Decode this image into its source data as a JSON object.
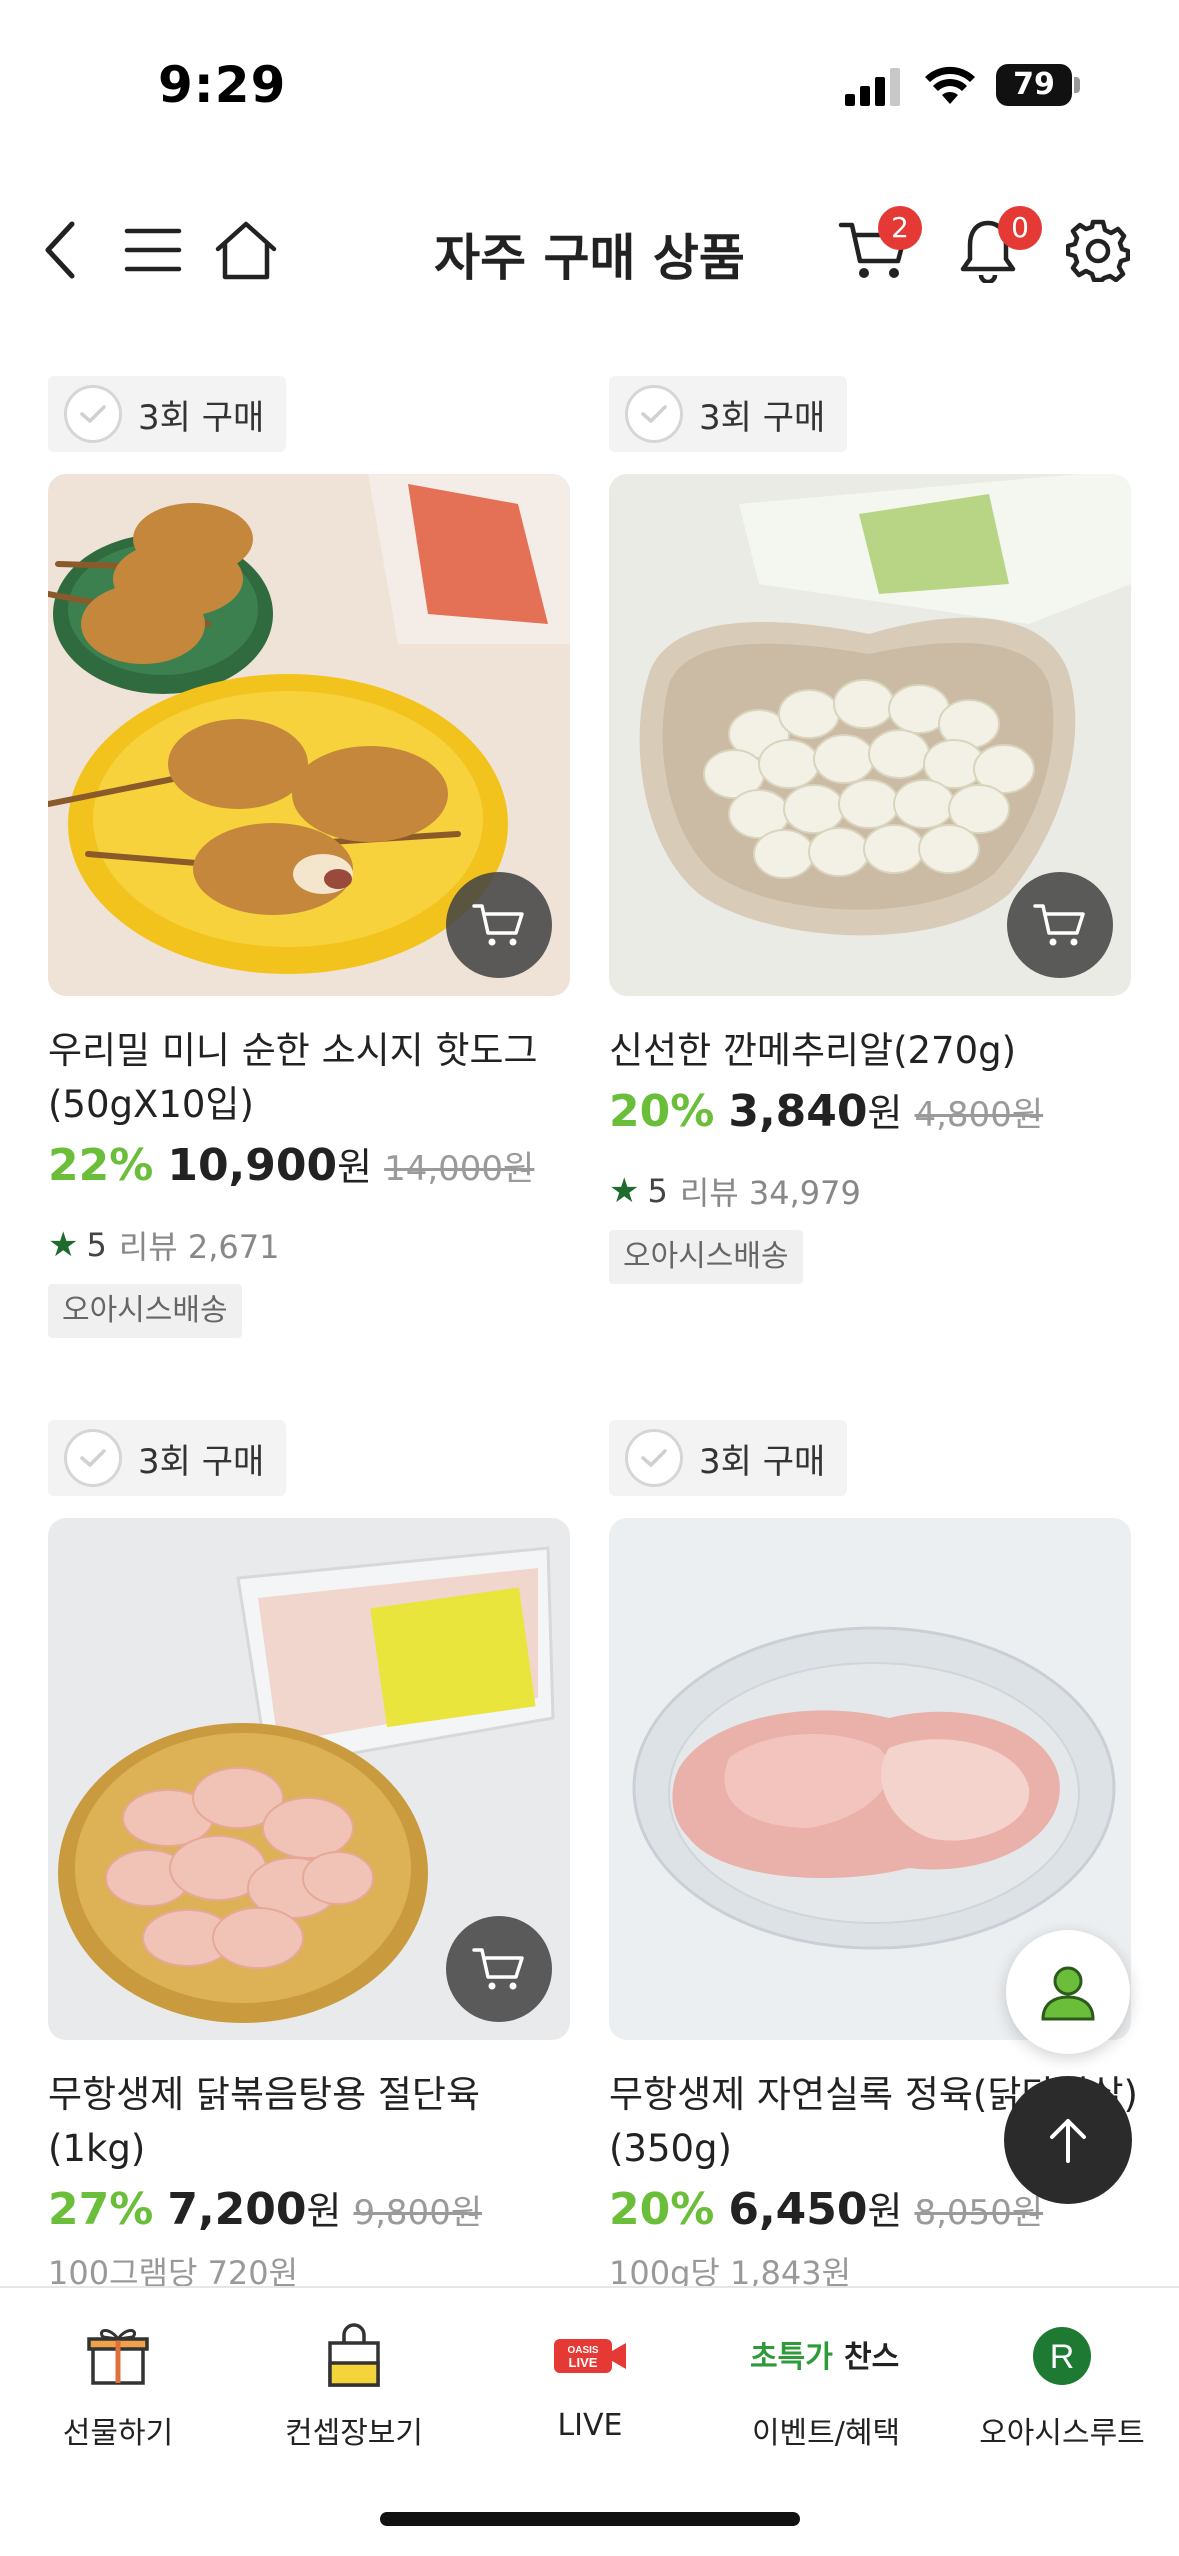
{
  "status_bar": {
    "time": "9:29",
    "battery": "79"
  },
  "header": {
    "title": "자주 구매 상품",
    "cart_count": "2",
    "notification_count": "0"
  },
  "products": [
    {
      "buy_count": "3회 구매",
      "name": "우리밀 미니 순한 소시지 핫도그 (50gX10입)",
      "discount": "22%",
      "price": "10,900",
      "won": "원",
      "original_price": "14,000원",
      "rating": "5",
      "reviews": "리뷰 2,671",
      "tag": "오아시스배송"
    },
    {
      "buy_count": "3회 구매",
      "name": "신선한 깐메추리알(270g)",
      "discount": "20%",
      "price": "3,840",
      "won": "원",
      "original_price": "4,800원",
      "rating": "5",
      "reviews": "리뷰 34,979",
      "tag": "오아시스배송"
    },
    {
      "buy_count": "3회 구매",
      "name": "무항생제 닭볶음탕용 절단육 (1kg)",
      "discount": "27%",
      "price": "7,200",
      "won": "원",
      "original_price": "9,800원",
      "unit_price": "100그램당 720원"
    },
    {
      "buy_count": "3회 구매",
      "name": "무항생제 자연실록 정육(닭다리살) (350g)",
      "discount": "20%",
      "price": "6,450",
      "won": "원",
      "original_price": "8,050원",
      "unit_price": "100g당 1,843원"
    }
  ],
  "tabbar": {
    "items": [
      {
        "label": "선물하기",
        "icon": "gift-icon"
      },
      {
        "label": "컨셉장보기",
        "icon": "shopping-bag-icon"
      },
      {
        "label": "LIVE",
        "icon": "oasis-live-icon",
        "icon_text": "OASIS LIVE"
      },
      {
        "label": "이벤트/혜택",
        "icon": "special-chance-icon",
        "icon_text_1": "초특가",
        "icon_text_2": "찬스"
      },
      {
        "label": "오아시스루트",
        "icon": "route-r-icon",
        "icon_text": "R"
      }
    ]
  },
  "colors": {
    "accent_green": "#6abe3a",
    "badge_red": "#e53935",
    "star_green": "#1f6b2c",
    "route_green": "#1e7a32"
  }
}
